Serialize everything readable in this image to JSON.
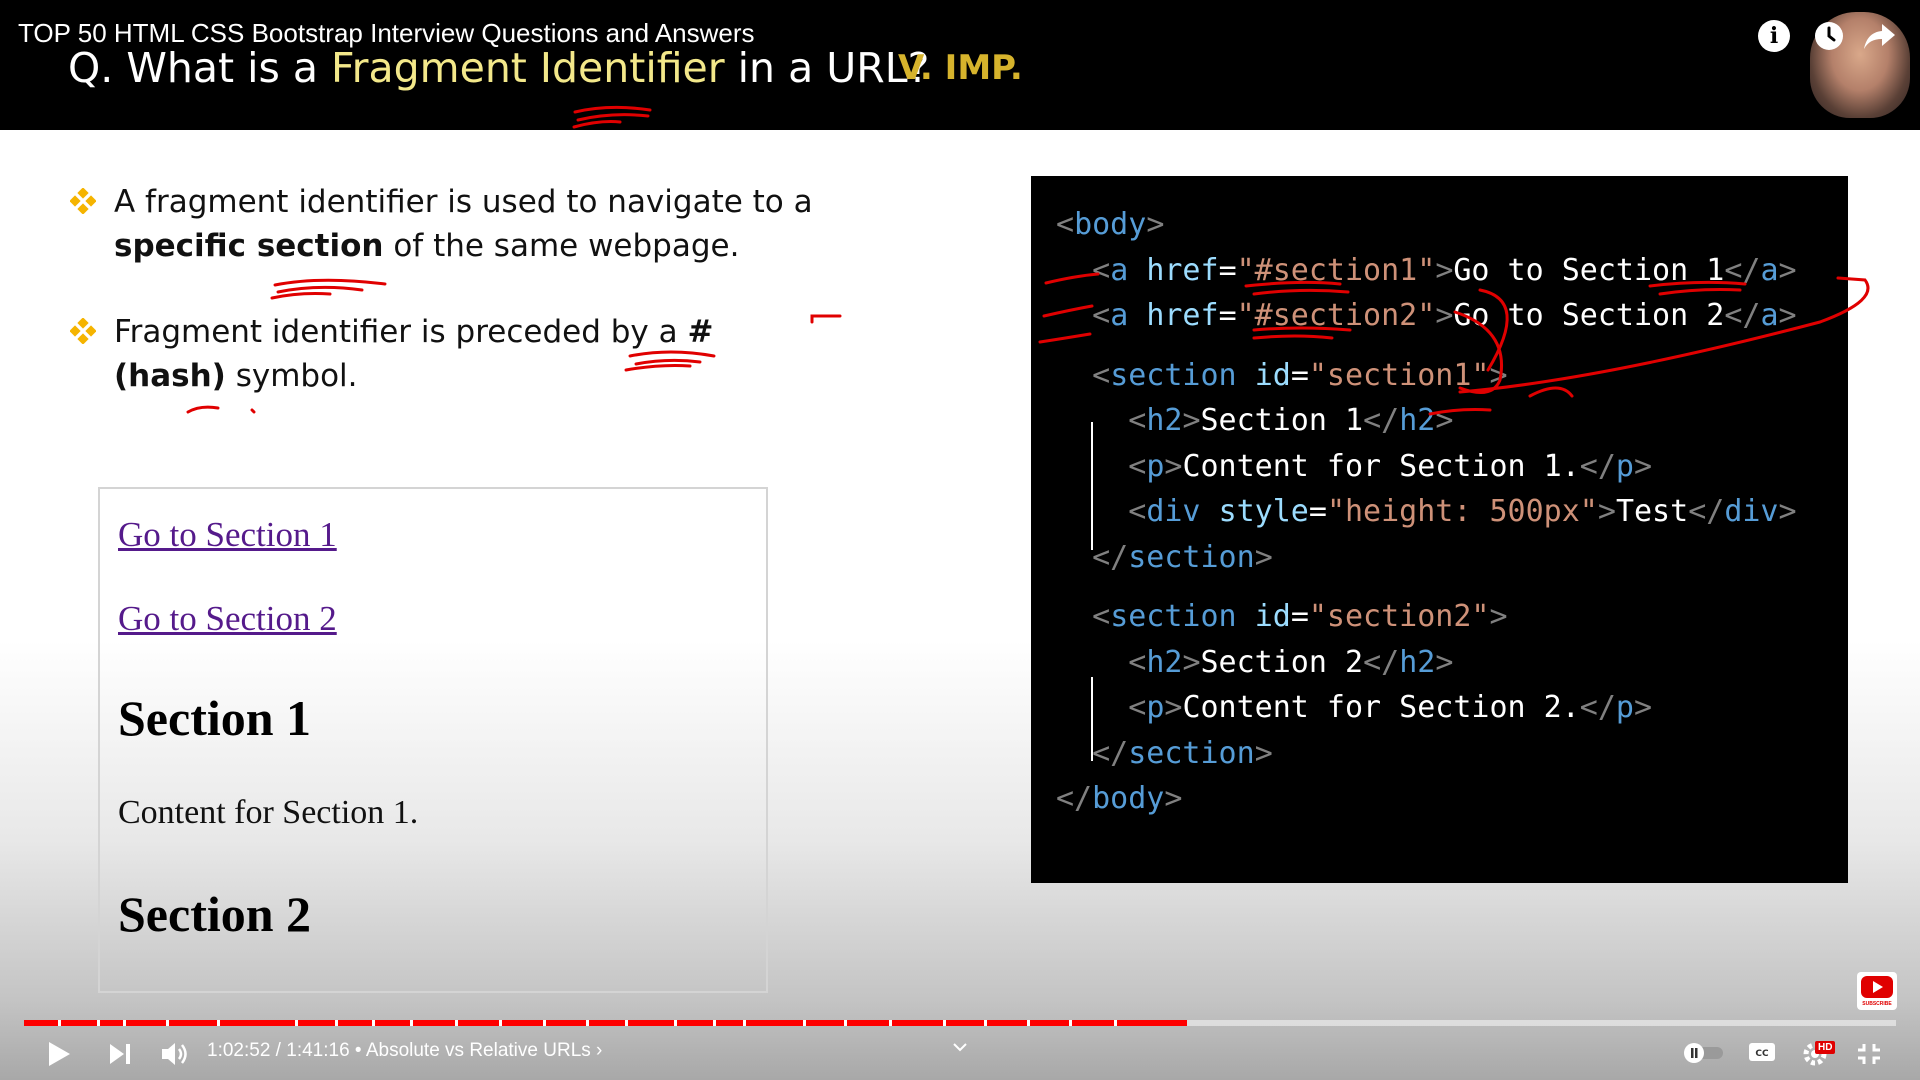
{
  "video": {
    "title": "TOP 50 HTML CSS Bootstrap Interview Questions and Answers"
  },
  "slide": {
    "question_prefix": "Q. What is a ",
    "question_highlight": "Fragment Identifier",
    "question_suffix": " in a URL?",
    "importance_badge": "V. IMP.",
    "bullets": [
      {
        "part1": "A fragment identifier is used to navigate to a ",
        "bold": "specific section",
        "part2": " of the same webpage."
      },
      {
        "part1": "Fragment identifier is preceded by a ",
        "bold": "# (hash)",
        "part2": " symbol."
      }
    ],
    "demo": {
      "link1": "Go to Section 1",
      "link2": "Go to Section 2",
      "heading1": "Section 1",
      "content1": "Content for Section 1.",
      "heading2": "Section 2"
    },
    "code_lines": [
      "<body>",
      "<a href=\"#section1\">Go to Section 1</a>",
      "<a href=\"#section2\">Go to Section 2</a>",
      "<section id=\"section1\">",
      "<h2>Section 1</h2>",
      "<p>Content for Section 1.</p>",
      "<div style=\"height: 500px\">Test</div>",
      "</section>",
      "<section id=\"section2\">",
      "<h2>Section 2</h2>",
      "<p>Content for Section 2.</p>",
      "</section>",
      "</body>"
    ]
  },
  "player": {
    "time_current": "1:02:52",
    "time_total": "1:41:16",
    "chapter": "Absolute vs Relative URLs",
    "progress": 0.621,
    "hd_badge": "HD",
    "subscribe_label": "SUBSCRIBE"
  },
  "colors": {
    "accent_red": "#ff0000",
    "highlight_yellow": "#f3e88a",
    "badge_gold": "#d6b32c",
    "bullet_diamond": "#f5b400"
  }
}
